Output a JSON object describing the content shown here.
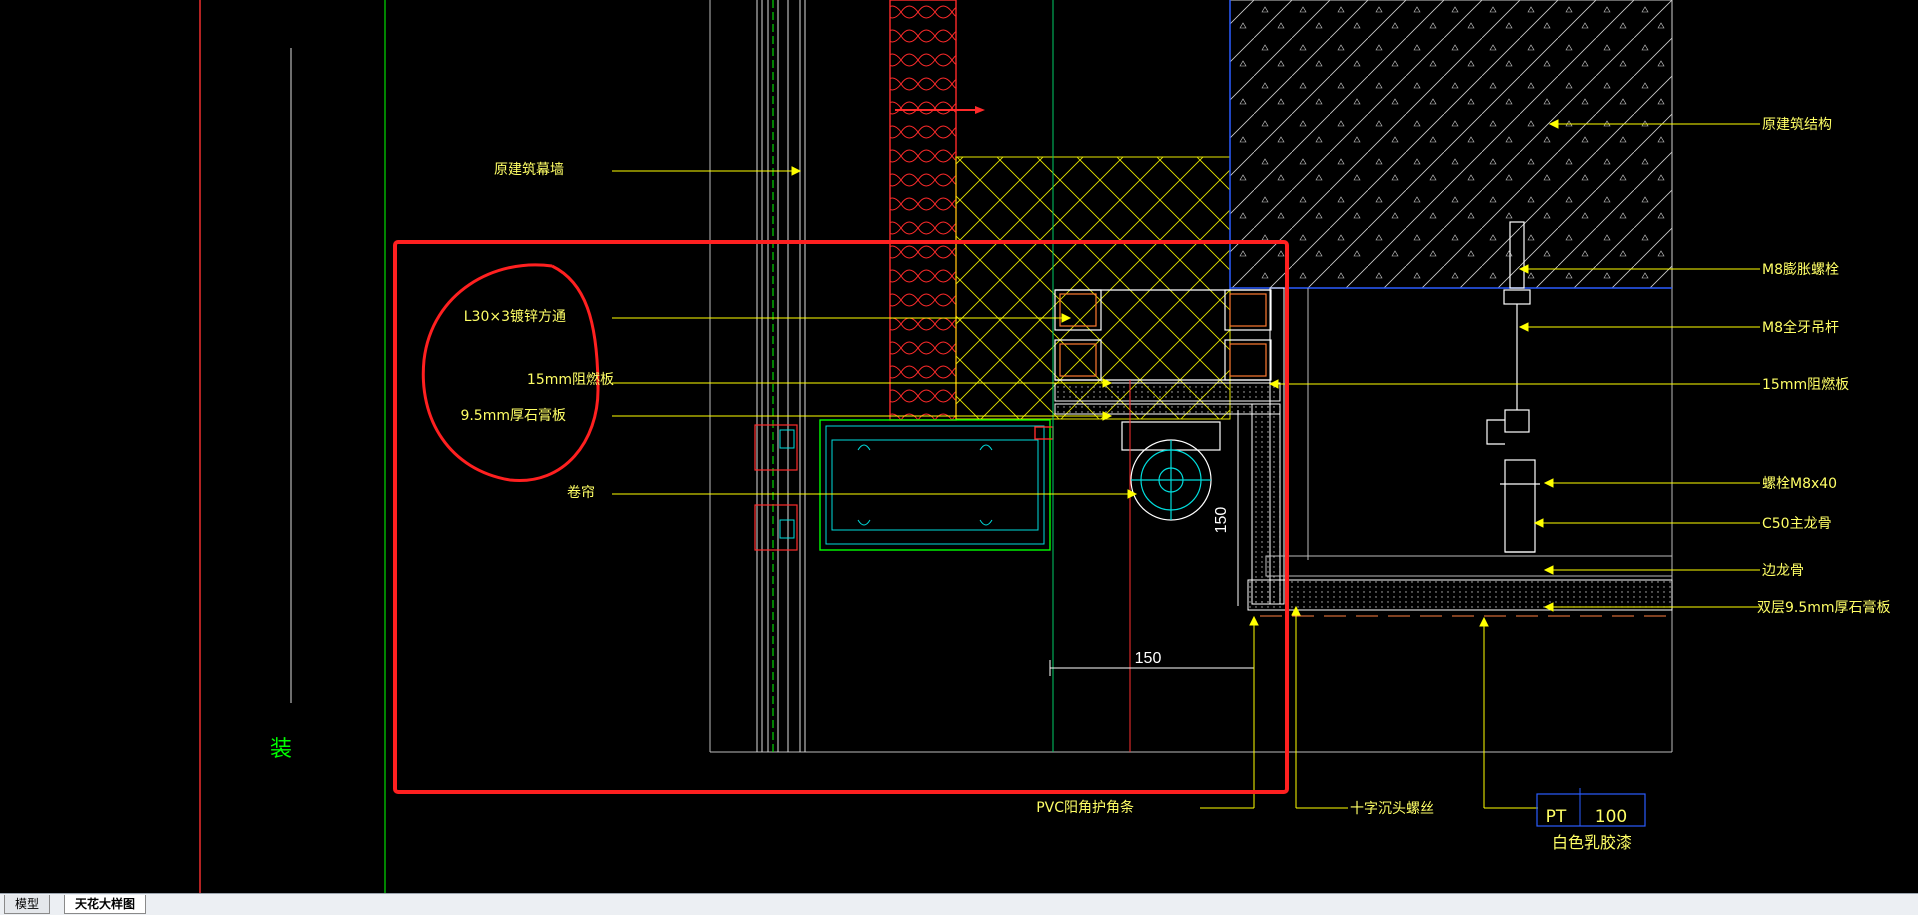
{
  "drawing": {
    "labels": {
      "curtain_wall": "原建筑幕墙",
      "angle_steel": "L30×3镀锌方通",
      "fire_board_left": "15mm阻燃板",
      "gypsum_left": "9.5mm厚石膏板",
      "curtain": "卷帘",
      "structure": "原建筑结构",
      "expansion_bolt": "M8膨胀螺栓",
      "threaded_rod": "M8全牙吊杆",
      "fire_board_right": "15mm阻燃板",
      "bolt": "螺栓M8x40",
      "c50_keel": "C50主龙骨",
      "edge_keel": "边龙骨",
      "double_gypsum": "双层9.5mm厚石膏板",
      "pvc_corner": "PVC阳角护角条",
      "cross_screw": "十字沉头螺丝",
      "paint": "白色乳胶漆",
      "side_char": "装"
    },
    "dims": {
      "dim_150_h": "150",
      "dim_150_v": "150"
    },
    "pt_tag": {
      "code": "PT",
      "number": "100"
    }
  },
  "tabs": [
    {
      "label": "模型",
      "active": false
    },
    {
      "label": "天花大样图",
      "active": true
    }
  ],
  "colors": {
    "background": "#000000",
    "leader": "#ffff00",
    "annotation": "#ff2020",
    "structure": "#ffffff",
    "glass": "#00ff00",
    "section": "#00ffff",
    "bluebox": "#2a5cff"
  }
}
